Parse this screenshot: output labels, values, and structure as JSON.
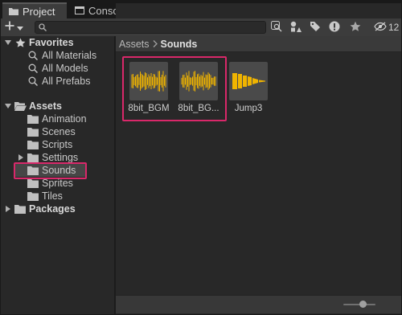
{
  "tabs": [
    {
      "label": "Project",
      "icon": "folder-icon"
    },
    {
      "label": "Console",
      "icon": "console-icon"
    }
  ],
  "toolbar": {
    "search_value": "",
    "hidden_count": "12"
  },
  "tree": {
    "favorites_label": "Favorites",
    "favorites": [
      "All Materials",
      "All Models",
      "All Prefabs"
    ],
    "assets_label": "Assets",
    "assets_children": [
      "Animation",
      "Scenes",
      "Scripts",
      "Settings",
      "Sounds",
      "Sprites",
      "Tiles"
    ],
    "packages_label": "Packages",
    "selected": "Sounds"
  },
  "breadcrumb": {
    "root": "Assets",
    "current": "Sounds"
  },
  "assets": [
    {
      "name": "8bit_BGM",
      "type": "audio-waveform"
    },
    {
      "name": "8bit_BG...",
      "type": "audio-waveform"
    },
    {
      "name": "Jump3",
      "type": "audio-decay"
    }
  ],
  "zoom": {
    "value": 0.6
  },
  "colors": {
    "accent": "#d9286a",
    "waveform": "#f0b400"
  }
}
